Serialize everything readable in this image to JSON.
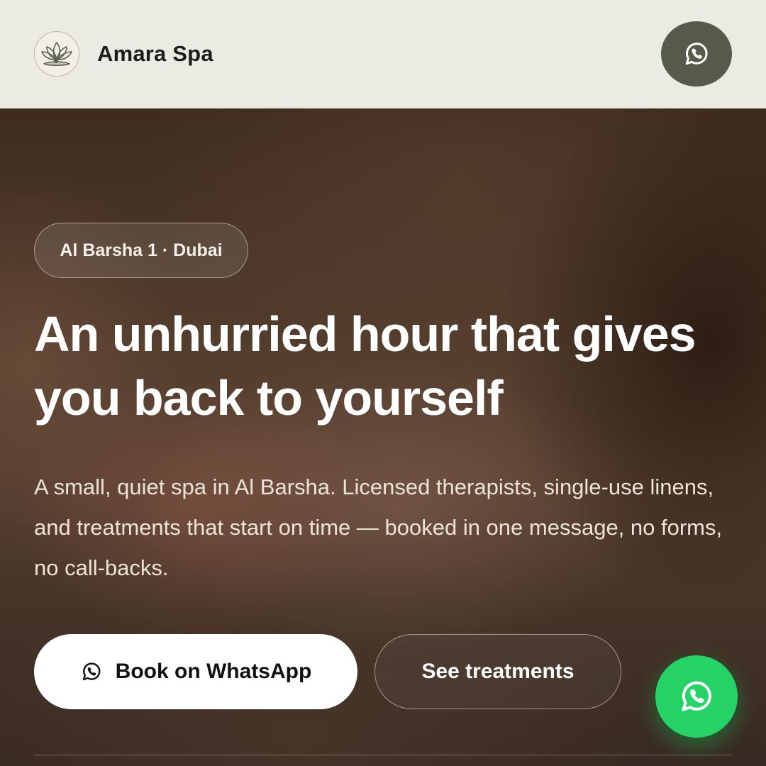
{
  "header": {
    "brand_name": "Amara Spa",
    "logo_icon": "lotus-icon",
    "whatsapp_icon": "whatsapp-icon"
  },
  "hero": {
    "location_badge": "Al Barsha 1 · Dubai",
    "headline": "An unhurried hour that gives you back to yourself",
    "subtext": "A small, quiet spa in Al Barsha. Licensed therapists, single-use linens, and treatments that start on time — booked in one message, no forms, no call-backs.",
    "primary_button_label": "Book on WhatsApp",
    "secondary_button_label": "See treatments"
  },
  "floating": {
    "whatsapp_icon": "whatsapp-icon"
  },
  "colors": {
    "header_bg": "#ecebe3",
    "header_button": "#565a4a",
    "whatsapp_green": "#25d366",
    "hero_overlay": "#4a3427"
  }
}
